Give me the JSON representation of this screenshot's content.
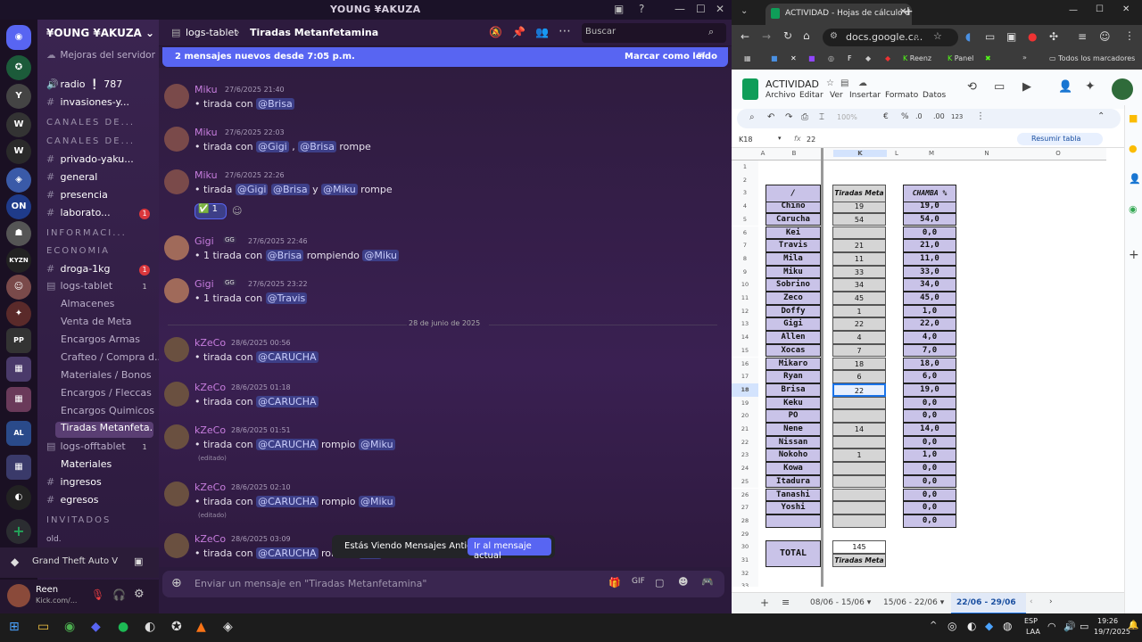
{
  "discord": {
    "window_title": "YOUNG ¥AKUZA",
    "server_name": "¥OUNG ¥AKUZA",
    "boost_text": "Mejoras del servidor",
    "voice": [
      {
        "label": "radio ❕ 787"
      },
      {
        "label": "invasiones-y..."
      }
    ],
    "categories": [
      "CANALES DE...",
      "CANALES DE...",
      "INFORMACI...",
      "ECONOMIA",
      "INVITADOS"
    ],
    "channels": [
      {
        "label": "privado-yaku...",
        "badge": ""
      },
      {
        "label": "general",
        "badge": ""
      },
      {
        "label": "presencia",
        "badge": ""
      },
      {
        "label": "laborato...",
        "badge": "1"
      },
      {
        "label": "droga-1kg",
        "badge": "1"
      },
      {
        "label": "logs-tablet",
        "badge": "1"
      },
      {
        "label": "Almacenes",
        "badge": ""
      },
      {
        "label": "Venta de Meta",
        "badge": ""
      },
      {
        "label": "Encargos Armas",
        "badge": ""
      },
      {
        "label": "Crafteo / Compra d...",
        "badge": ""
      },
      {
        "label": "Materiales / Bonos",
        "badge": ""
      },
      {
        "label": "Encargos / Fleccas",
        "badge": ""
      },
      {
        "label": "Encargos Quimicos",
        "badge": ""
      },
      {
        "label": "Tiradas Metanfeta...",
        "badge": ""
      },
      {
        "label": "logs-offtablet",
        "badge": "1"
      },
      {
        "label": "Materiales",
        "badge": ""
      },
      {
        "label": "ingresos",
        "badge": ""
      },
      {
        "label": "egresos",
        "badge": ""
      },
      {
        "label": "old.",
        "badge": ""
      }
    ],
    "activity": "Grand Theft Auto V",
    "user": {
      "name": "Reen",
      "status": "Kick.com/..."
    },
    "header": {
      "parent": "logs-tablet",
      "sep": "›",
      "channel": "Tiradas Metanfetamina",
      "search_placeholder": "Buscar"
    },
    "new_messages": {
      "text": "2 mensajes nuevos desde 7:05 p.m.",
      "action": "Marcar como leído"
    },
    "day_divider": "28 de junio de 2025",
    "messages": [
      {
        "author": "Miku",
        "time": "27/6/2025 21:40",
        "text": "tirada con ",
        "mentions": [
          "@Brisa"
        ],
        "tail": ""
      },
      {
        "author": "Miku",
        "time": "27/6/2025 22:03",
        "text": "tirada con ",
        "mentions": [
          "@Gigi",
          " , ",
          "@Brisa"
        ],
        "tail": " rompe"
      },
      {
        "author": "Miku",
        "time": "27/6/2025 22:26",
        "text": "tirada ",
        "mentions": [
          "@Gigi",
          " ",
          "@Brisa",
          "  y ",
          "@Miku"
        ],
        "tail": " rompe"
      },
      {
        "author": "Gigi",
        "time": "27/6/2025 22:46",
        "text": "1 tirada con ",
        "mentions": [
          "@Brisa",
          "  rompiendo ",
          "@Miku"
        ],
        "tail": ""
      },
      {
        "author": "Gigi",
        "time": "27/6/2025 23:22",
        "text": "1 tirada con ",
        "mentions": [
          "@Travis"
        ],
        "tail": ""
      },
      {
        "author": "kZeCo",
        "time": "28/6/2025 00:56",
        "text": "tirada con ",
        "mentions": [
          "@CARUCHA"
        ],
        "tail": ""
      },
      {
        "author": "kZeCo",
        "time": "28/6/2025 01:18",
        "text": "tirada con ",
        "mentions": [
          "@CARUCHA"
        ],
        "tail": ""
      },
      {
        "author": "kZeCo",
        "time": "28/6/2025 01:51",
        "text": "tirada con ",
        "mentions": [
          "@CARUCHA",
          " rompio ",
          "@Miku"
        ],
        "tail": ""
      },
      {
        "author": "kZeCo",
        "time": "28/6/2025 02:10",
        "text": "tirada con ",
        "mentions": [
          "@CARUCHA",
          " rompio ",
          "@Miku"
        ],
        "tail": ""
      },
      {
        "author": "kZeCo",
        "time": "28/6/2025 03:09",
        "text": "tirada con ",
        "mentions": [
          "@CARUCHA",
          " rompio ",
          "@..."
        ],
        "tail": ""
      }
    ],
    "reaction_count": "1",
    "gigi_tag": "GG",
    "edited": "(editado)",
    "old_banner": {
      "text": "Estás Viendo Mensajes Antiguos",
      "button": "Ir al mensaje actual"
    },
    "composer_placeholder": "Enviar un mensaje en \"Tiradas Metanfetamina\""
  },
  "chrome": {
    "tab_title": "ACTIVIDAD - Hojas de cálculo d",
    "url": "docs.google.c...",
    "bookmarks": [
      "Reenz",
      "Panel",
      "Todos los marcadores"
    ]
  },
  "sheets": {
    "title": "ACTIVIDAD",
    "menus": [
      "Archivo",
      "Editar",
      "Ver",
      "Insertar",
      "Formato",
      "Datos"
    ],
    "zoom": "100%",
    "currency": "€",
    "percent": "%",
    "dec1": ".0",
    "dec2": ".00",
    "numfmt": "123",
    "cell_ref": "K18",
    "formula": "22",
    "summarize": "Resumir tabla",
    "col_letters": [
      "A",
      "B",
      "K",
      "L",
      "M",
      "N",
      "O"
    ],
    "header_b": "/",
    "header_k": "Tiradas Meta",
    "header_m": "CHAMBA %",
    "rows": [
      {
        "n": "1",
        "name": null,
        "k": null,
        "m": null
      },
      {
        "n": "2",
        "name": null,
        "k": null,
        "m": null
      },
      {
        "n": "3",
        "name": null,
        "k": null,
        "m": null
      },
      {
        "n": "4",
        "name": "Chino",
        "k": "19",
        "m": "19,0"
      },
      {
        "n": "5",
        "name": "Carucha",
        "k": "54",
        "m": "54,0"
      },
      {
        "n": "6",
        "name": "Kei",
        "k": "",
        "m": "0,0"
      },
      {
        "n": "7",
        "name": "Travis",
        "k": "21",
        "m": "21,0"
      },
      {
        "n": "8",
        "name": "Mila",
        "k": "11",
        "m": "11,0"
      },
      {
        "n": "9",
        "name": "Miku",
        "k": "33",
        "m": "33,0"
      },
      {
        "n": "10",
        "name": "Sobrino",
        "k": "34",
        "m": "34,0"
      },
      {
        "n": "11",
        "name": "Zeco",
        "k": "45",
        "m": "45,0"
      },
      {
        "n": "12",
        "name": "Doffy",
        "k": "1",
        "m": "1,0"
      },
      {
        "n": "13",
        "name": "Gigi",
        "k": "22",
        "m": "22,0"
      },
      {
        "n": "14",
        "name": "Allen",
        "k": "4",
        "m": "4,0"
      },
      {
        "n": "15",
        "name": "Xocas",
        "k": "7",
        "m": "7,0"
      },
      {
        "n": "16",
        "name": "Mikaro",
        "k": "18",
        "m": "18,0"
      },
      {
        "n": "17",
        "name": "Ryan",
        "k": "6",
        "m": "6,0"
      },
      {
        "n": "18",
        "name": "Brisa",
        "k": "22",
        "m": "19,0"
      },
      {
        "n": "19",
        "name": "Keku",
        "k": "",
        "m": "0,0"
      },
      {
        "n": "20",
        "name": "PO",
        "k": "",
        "m": "0,0"
      },
      {
        "n": "21",
        "name": "Nene",
        "k": "14",
        "m": "14,0"
      },
      {
        "n": "22",
        "name": "Nissan",
        "k": "",
        "m": "0,0"
      },
      {
        "n": "23",
        "name": "Nokoho",
        "k": "1",
        "m": "1,0"
      },
      {
        "n": "24",
        "name": "Kowa",
        "k": "",
        "m": "0,0"
      },
      {
        "n": "25",
        "name": "Itadura",
        "k": "",
        "m": "0,0"
      },
      {
        "n": "26",
        "name": "Tanashi",
        "k": "",
        "m": "0,0"
      },
      {
        "n": "27",
        "name": "Yoshi",
        "k": "",
        "m": "0,0"
      },
      {
        "n": "28",
        "name": "",
        "k": "",
        "m": "0,0"
      },
      {
        "n": "29",
        "name": null,
        "k": null,
        "m": null
      },
      {
        "n": "30",
        "name": null,
        "k": null,
        "m": null
      },
      {
        "n": "31",
        "name": null,
        "k": null,
        "m": null
      },
      {
        "n": "32",
        "name": null,
        "k": null,
        "m": null
      },
      {
        "n": "33",
        "name": null,
        "k": null,
        "m": null
      }
    ],
    "total_label": "TOTAL",
    "total_value": "145",
    "total_footer": "Tiradas Meta",
    "tabs": [
      "08/06 - 15/06",
      "15/06 - 22/06",
      "22/06 - 29/06"
    ]
  },
  "taskbar": {
    "lang": "ESP",
    "lang2": "LAA",
    "time": "19:26",
    "date": "19/7/2025"
  },
  "colors": {
    "purple_cell": "#c9c3e8",
    "mention_bg": "#3d3f88",
    "discord_blurple": "#5865f2"
  }
}
